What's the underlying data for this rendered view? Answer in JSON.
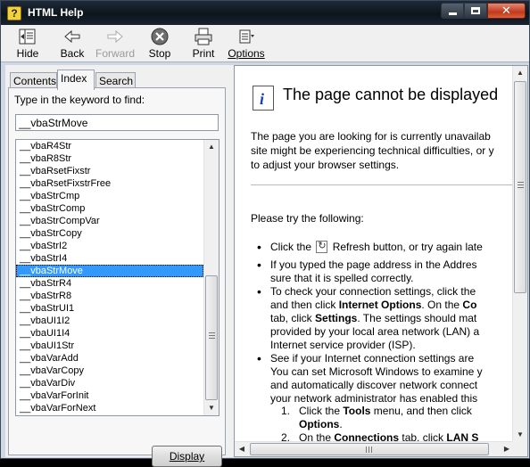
{
  "window": {
    "title": "HTML Help",
    "icon": "help-book-icon"
  },
  "toolbar": {
    "hide": "Hide",
    "back": "Back",
    "forward": "Forward",
    "stop": "Stop",
    "print": "Print",
    "options": "Options"
  },
  "tabs": {
    "contents": "Contents",
    "index": "Index",
    "search": "Search",
    "active": "Index"
  },
  "index": {
    "prompt": "Type in the keyword to find:",
    "keyword": "__vbaStrMove",
    "items": [
      "__vbaR4Str",
      "__vbaR8Str",
      "__vbaRsetFixstr",
      "__vbaRsetFixstrFree",
      "__vbaStrCmp",
      "__vbaStrComp",
      "__vbaStrCompVar",
      "__vbaStrCopy",
      "__vbaStrI2",
      "__vbaStrI4",
      "__vbaStrMove",
      "__vbaStrR4",
      "__vbaStrR8",
      "__vbaStrUI1",
      "__vbaUI1I2",
      "__vbaUI1I4",
      "__vbaUI1Str",
      "__vbaVarAdd",
      "__vbaVarCopy",
      "__vbaVarDiv",
      "__vbaVarForInit",
      "__vbaVarForNext"
    ],
    "selected_index": 10,
    "display_button": "Display"
  },
  "page": {
    "title": "The page cannot be displayed",
    "intro_lines": [
      "The page you are looking for is currently unavailab",
      "site might be experiencing technical difficulties, or y",
      "to adjust your browser settings."
    ],
    "try_heading": "Please try the following:",
    "bullets": [
      [
        "Click the ",
        " Refresh button, or try again late"
      ],
      [
        "If you typed the page address in the Addres",
        "sure that it is spelled correctly."
      ],
      [
        "To check your connection settings, click the",
        "and then click Internet Options. On the Co",
        "tab, click Settings. The settings should mat",
        "provided by your local area network (LAN) a",
        "Internet service provider (ISP)."
      ],
      [
        "See if your Internet connection settings are",
        "You can set Microsoft Windows to examine y",
        "and automatically discover network connect",
        "your network administrator has enabled this"
      ]
    ],
    "steps": [
      [
        "1.",
        "Click the Tools menu, and then click",
        "Options."
      ],
      [
        "2.",
        "On the Connections tab, click LAN S"
      ]
    ]
  }
}
